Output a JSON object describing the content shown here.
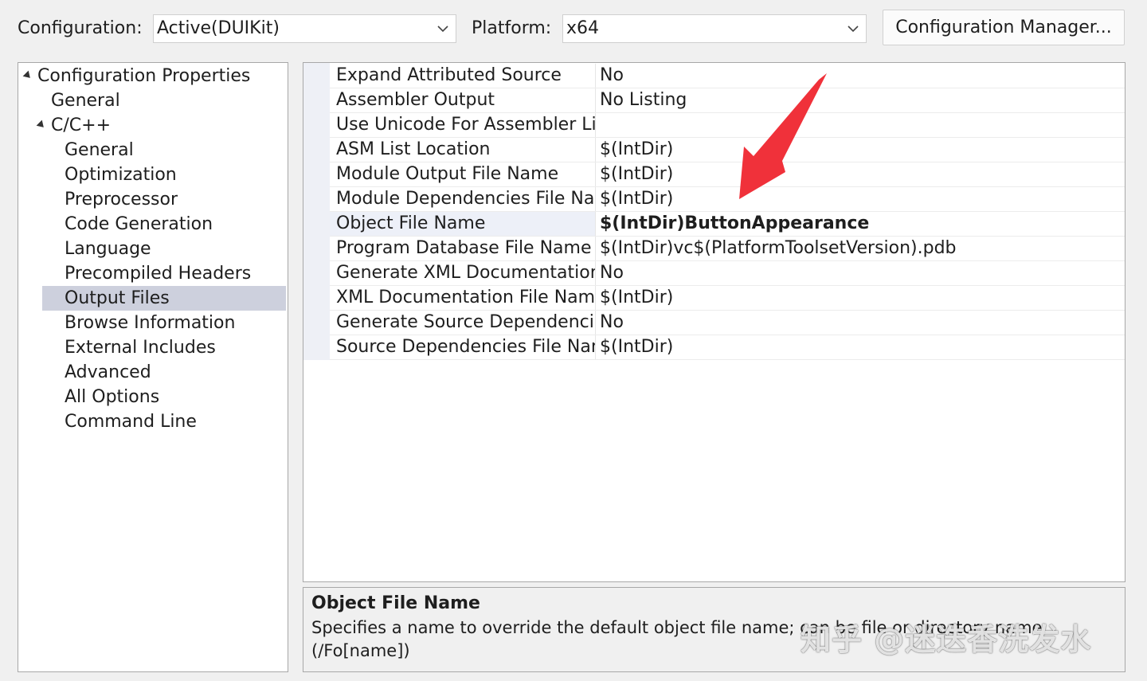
{
  "toolbar": {
    "configuration_label": "Configuration:",
    "configuration_value": "Active(DUIKit)",
    "platform_label": "Platform:",
    "platform_value": "x64",
    "config_manager_label": "Configuration Manager..."
  },
  "tree": {
    "root_label": "Configuration Properties",
    "general_label": "General",
    "cpp_label": "C/C++",
    "cpp_children": [
      "General",
      "Optimization",
      "Preprocessor",
      "Code Generation",
      "Language",
      "Precompiled Headers",
      "Output Files",
      "Browse Information",
      "External Includes",
      "Advanced",
      "All Options",
      "Command Line"
    ],
    "selected": "Output Files"
  },
  "properties": [
    {
      "name": "Expand Attributed Source",
      "value": "No"
    },
    {
      "name": "Assembler Output",
      "value": "No Listing"
    },
    {
      "name": "Use Unicode For Assembler List",
      "value": ""
    },
    {
      "name": "ASM List Location",
      "value": "$(IntDir)"
    },
    {
      "name": "Module Output File Name",
      "value": "$(IntDir)"
    },
    {
      "name": "Module Dependencies File Nam",
      "value": "$(IntDir)"
    },
    {
      "name": "Object File Name",
      "value": "$(IntDir)ButtonAppearance"
    },
    {
      "name": "Program Database File Name",
      "value": "$(IntDir)vc$(PlatformToolsetVersion).pdb"
    },
    {
      "name": "Generate XML Documentation I",
      "value": "No"
    },
    {
      "name": "XML Documentation File Name",
      "value": "$(IntDir)"
    },
    {
      "name": "Generate Source Dependencies",
      "value": "No"
    },
    {
      "name": "Source Dependencies File Nam",
      "value": "$(IntDir)"
    }
  ],
  "description": {
    "title": "Object File Name",
    "text": "Specifies a name to override the default object file name; can be file or directory name. (/Fo[name])"
  },
  "watermark": "知乎 @迷迭香洗发水",
  "colors": {
    "selection": "#cdd0dd",
    "annotation_arrow": "#f0313a"
  }
}
